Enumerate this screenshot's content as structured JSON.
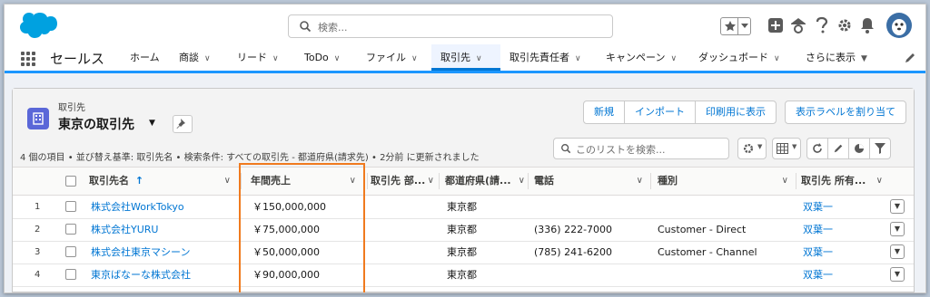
{
  "header": {
    "search_placeholder": "検索...",
    "icons": [
      "favorites-star-icon",
      "favorites-dropdown-icon",
      "global-add-icon",
      "trailhead-icon",
      "help-icon",
      "setup-gear-icon",
      "notification-bell-icon",
      "avatar"
    ]
  },
  "nav": {
    "app_name": "セールス",
    "items": [
      {
        "label": "ホーム",
        "has_menu": false
      },
      {
        "label": "商談",
        "has_menu": true
      },
      {
        "label": "リード",
        "has_menu": true
      },
      {
        "label": "ToDo",
        "has_menu": true
      },
      {
        "label": "ファイル",
        "has_menu": true
      },
      {
        "label": "取引先",
        "has_menu": true,
        "active": true
      },
      {
        "label": "取引先責任者",
        "has_menu": true
      },
      {
        "label": "キャンペーン",
        "has_menu": true
      },
      {
        "label": "ダッシュボード",
        "has_menu": true
      },
      {
        "label": "さらに表示",
        "has_menu": true
      }
    ]
  },
  "list": {
    "object_label": "取引先",
    "title": "東京の取引先",
    "info": "4 個の項目 • 並び替え基準: 取引先名 • 検索条件: すべての取引先 - 都道府県(請求先) • 2分前 に更新されました",
    "search_placeholder": "このリストを検索...",
    "buttons": {
      "new": "新規",
      "import": "インポート",
      "print": "印刷用に表示",
      "assign_label": "表示ラベルを割り当て"
    },
    "columns": {
      "name": "取引先名",
      "sort_arrow": "↑",
      "revenue": "年間売上",
      "division": "取引先 部...",
      "state": "都道府県(請...",
      "phone": "電話",
      "type": "種別",
      "owner": "取引先 所有..."
    },
    "rows": [
      {
        "num": "1",
        "name": "株式会社WorkTokyo",
        "revenue": "￥150,000,000",
        "state": "東京都",
        "phone": "",
        "type": "",
        "owner": "双葉一"
      },
      {
        "num": "2",
        "name": "株式会社YURU",
        "revenue": "￥75,000,000",
        "state": "東京都",
        "phone": "(336) 222-7000",
        "type": "Customer - Direct",
        "owner": "双葉一"
      },
      {
        "num": "3",
        "name": "株式会社東京マシーン",
        "revenue": "￥50,000,000",
        "state": "東京都",
        "phone": "(785) 241-6200",
        "type": "Customer - Channel",
        "owner": "双葉一"
      },
      {
        "num": "4",
        "name": "東京ばなーな株式会社",
        "revenue": "￥90,000,000",
        "state": "東京都",
        "phone": "",
        "type": "",
        "owner": "双葉一"
      }
    ]
  },
  "colors": {
    "brand_blue": "#0176d3",
    "nav_underline": "#1b96ff",
    "highlight_orange": "#f07a1e",
    "cloud_logo": "#00a1e0",
    "account_icon": "#5a67d8"
  }
}
